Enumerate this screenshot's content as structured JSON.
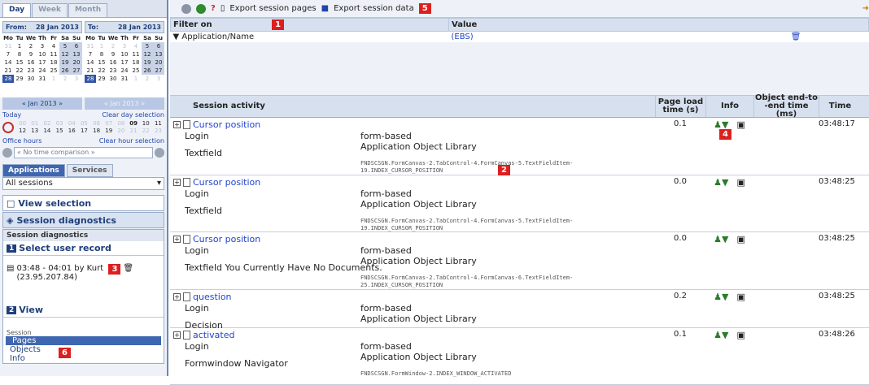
{
  "calendar": {
    "tabs": [
      "Day",
      "Week",
      "Month"
    ],
    "from_label": "From:",
    "from_date": "28 Jan 2013",
    "to_label": "To:",
    "to_date": "28 Jan 2013",
    "month_nav": "« Jan 2013 »",
    "month_nav_dim": "« Jan 2013 »",
    "today": "Today",
    "clear_day": "Clear day selection",
    "hours_row1": [
      "00",
      "01",
      "02",
      "03",
      "04",
      "05",
      "06",
      "07",
      "08",
      "09",
      "10",
      "11"
    ],
    "hours_row2": [
      "12",
      "13",
      "14",
      "15",
      "16",
      "17",
      "18",
      "19",
      "20",
      "21",
      "22",
      "23"
    ],
    "office_hours": "Office hours",
    "clear_hour": "Clear hour selection",
    "comparison": "« No time comparison »"
  },
  "nav": {
    "app_tab": "Applications",
    "services_tab": "Services",
    "sessions_select": "All sessions",
    "view_selection": "View selection",
    "session_diagnostics": "Session diagnostics",
    "sub_head": "Session diagnostics",
    "step1_num": "1",
    "step1": "Select user record",
    "user_record": "03:48 - 04:01 by Kurt (23.95.207.84)",
    "step2_num": "2",
    "step2": "View",
    "session_label": "Session",
    "links": [
      "Pages",
      "Objects",
      "Info"
    ]
  },
  "badges": [
    "1",
    "2",
    "3",
    "4",
    "5",
    "6"
  ],
  "toolbar": {
    "export_pages": "Export session pages",
    "export_data": "Export session data"
  },
  "filter": {
    "col1": "Filter on",
    "col2": "Value",
    "row_name": "Application/Name",
    "row_value": "(EBS)"
  },
  "activity": {
    "headers": [
      "Session activity",
      "Page load time (s)",
      "Info",
      "Object end-to -end time (ms)",
      "Time"
    ],
    "rows": [
      {
        "title": "Cursor position",
        "sub1": "Login",
        "sub2": "Textfield",
        "mid1": "form-based",
        "mid2": "Application Object Library",
        "mono": "FNDSCSGN.FormCanvas-2.TabControl-4.FormCanvas-5.TextFieldItem-19.INDEX_CURSOR_POSITION",
        "load": "0.1",
        "time": "03:48:17"
      },
      {
        "title": "Cursor position",
        "sub1": "Login",
        "sub2": "Textfield",
        "mid1": "form-based",
        "mid2": "Application Object Library",
        "mono": "FNDSCSGN.FormCanvas-2.TabControl-4.FormCanvas-5.TextFieldItem-19.INDEX_CURSOR_POSITION",
        "load": "0.0",
        "time": "03:48:25"
      },
      {
        "title": "Cursor position",
        "sub1": "Login",
        "sub2": "Textfield You Currently Have No Documents.",
        "mid1": "form-based",
        "mid2": "Application Object Library",
        "mono": "FNDSCSGN.FormCanvas-2.TabControl-4.FormCanvas-6.TextFieldItem-25.INDEX_CURSOR_POSITION",
        "load": "0.0",
        "time": "03:48:25"
      },
      {
        "title": "question",
        "sub1": "Login",
        "sub2": "Decision",
        "mid1": "form-based",
        "mid2": "Application Object Library",
        "mono": "",
        "load": "0.2",
        "time": "03:48:25"
      },
      {
        "title": "activated",
        "sub1": "Login",
        "sub2": "Formwindow Navigator",
        "mid1": "form-based",
        "mid2": "Application Object Library",
        "mono": "FNDSCSGN.FormWindow-2.INDEX_WINDOW_ACTIVATED",
        "load": "0.1",
        "time": "03:48:26"
      }
    ]
  }
}
